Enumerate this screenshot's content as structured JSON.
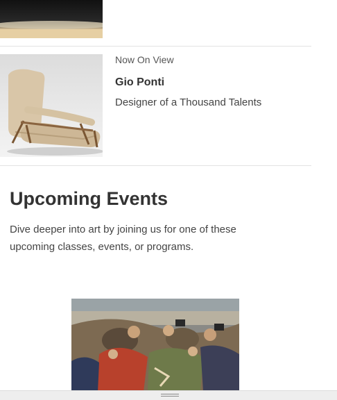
{
  "exhibit": {
    "status": "Now On View",
    "title": "Gio Ponti",
    "subtitle": "Designer of a Thousand Talents"
  },
  "upcoming": {
    "heading": "Upcoming Events",
    "description": "Dive deeper into art by joining us for one of these upcoming classes, events, or programs."
  },
  "icons": {
    "drawer": "drag-handle-icon"
  },
  "colors": {
    "text": "#333333",
    "divider": "#e2e2e2",
    "background": "#ffffff"
  }
}
